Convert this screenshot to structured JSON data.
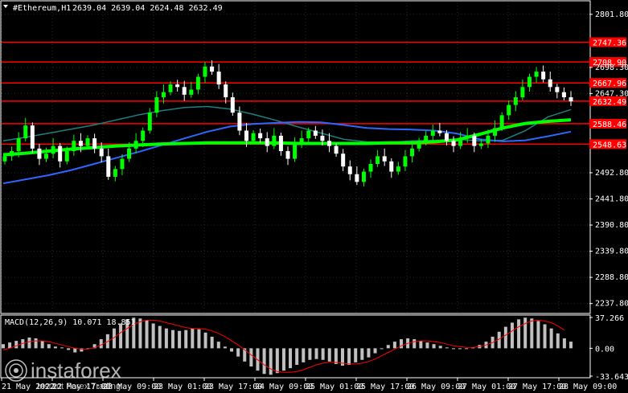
{
  "header": {
    "symbol": "#Ethereum,H1",
    "ohlc": "2639.04 2639.04 2624.48 2632.49"
  },
  "macd": {
    "label": "MACD(12,26,9) 10.071 18.851",
    "ticks": [
      "37.266",
      "0.00",
      "-33.643"
    ]
  },
  "watermark": {
    "brand": "instaforex",
    "tagline": "Instant Forex Trading"
  },
  "colors": {
    "background": "#000000",
    "bull_candle": "#00ff00",
    "bear_candle": "#ffffff",
    "level_line": "#ff0000",
    "ma_fast": "#00ff00",
    "ma_mid": "#2f66ff",
    "ma_slow": "#1f7f7f",
    "macd_hist": "#c0c0c0",
    "macd_signal": "#ff0000"
  },
  "chart_data": [
    {
      "type": "candlestick",
      "ylim": [
        2220,
        2825
      ],
      "y_ticks": [
        2801.8,
        2698.3,
        2647.3,
        2492.8,
        2441.8,
        2390.8,
        2339.8,
        2288.8,
        2237.8
      ],
      "x_labels": [
        "21 May 2022",
        "22 May 17:00",
        "23 May 09:00",
        "23 May 01:00",
        "23 May 17:00",
        "24 May 09:00",
        "25 May 01:00",
        "25 May 17:00",
        "26 May 09:00",
        "27 May 01:00",
        "27 May 17:00",
        "28 May 09:00"
      ],
      "levels": [
        {
          "value": 2747.36,
          "label": "2747.36"
        },
        {
          "value": 2708.9,
          "label": "2708.90"
        },
        {
          "value": 2667.96,
          "label": "2667.96"
        },
        {
          "value": 2632.49,
          "label": "2632.49"
        },
        {
          "value": 2588.46,
          "label": "2588.46"
        },
        {
          "value": 2548.63,
          "label": "2548.63"
        }
      ],
      "close": [
        2525,
        2535,
        2560,
        2585,
        2540,
        2520,
        2530,
        2545,
        2515,
        2535,
        2555,
        2545,
        2560,
        2540,
        2525,
        2485,
        2500,
        2520,
        2540,
        2555,
        2575,
        2610,
        2640,
        2650,
        2665,
        2660,
        2645,
        2655,
        2680,
        2700,
        2690,
        2665,
        2640,
        2610,
        2575,
        2555,
        2570,
        2560,
        2545,
        2565,
        2535,
        2520,
        2550,
        2560,
        2575,
        2565,
        2555,
        2545,
        2530,
        2505,
        2490,
        2475,
        2495,
        2510,
        2525,
        2515,
        2495,
        2505,
        2525,
        2540,
        2555,
        2565,
        2575,
        2570,
        2555,
        2545,
        2560,
        2565,
        2545,
        2550,
        2565,
        2580,
        2605,
        2625,
        2640,
        2660,
        2680,
        2690,
        2675,
        2660,
        2650,
        2640,
        2632
      ],
      "series": [
        {
          "key": "ma_fast",
          "values": [
            2528,
            2531,
            2535,
            2539,
            2542,
            2545,
            2547,
            2549,
            2550,
            2551,
            2551,
            2551,
            2551,
            2550,
            2550,
            2550,
            2550,
            2551,
            2551,
            2553,
            2557,
            2568,
            2580,
            2589,
            2593,
            2596
          ]
        },
        {
          "key": "ma_mid",
          "values": [
            2472,
            2480,
            2488,
            2498,
            2510,
            2522,
            2534,
            2547,
            2560,
            2573,
            2583,
            2588,
            2590,
            2592,
            2591,
            2586,
            2580,
            2578,
            2577,
            2575,
            2569,
            2558,
            2554,
            2556,
            2564,
            2573
          ]
        },
        {
          "key": "ma_slow",
          "values": [
            2555,
            2562,
            2570,
            2578,
            2586,
            2596,
            2606,
            2614,
            2620,
            2622,
            2617,
            2607,
            2595,
            2582,
            2570,
            2558,
            2553,
            2552,
            2555,
            2556,
            2558,
            2555,
            2556,
            2575,
            2602,
            2616
          ]
        }
      ]
    },
    {
      "type": "bar",
      "name": "MACD",
      "ylim": [
        -33.643,
        37.266
      ],
      "values": [
        5,
        7,
        9,
        11,
        13,
        12,
        9,
        5,
        2,
        1,
        -2,
        -5,
        -4,
        0,
        5,
        11,
        17,
        24,
        30,
        35,
        37,
        36,
        34,
        30,
        27,
        24,
        22,
        21,
        22,
        24,
        23,
        19,
        14,
        8,
        2,
        -4,
        -10,
        -16,
        -22,
        -27,
        -31,
        -32,
        -30,
        -27,
        -24,
        -20,
        -17,
        -14,
        -13,
        -14,
        -16,
        -19,
        -21,
        -20,
        -17,
        -14,
        -11,
        -6,
        -1,
        4,
        8,
        11,
        12,
        11,
        9,
        7,
        5,
        3,
        1,
        -1,
        -1,
        0,
        1,
        4,
        8,
        14,
        20,
        26,
        31,
        35,
        37,
        36,
        33,
        29,
        24,
        18,
        12,
        8
      ],
      "signal": [
        -2,
        0,
        3,
        6,
        8,
        9,
        9,
        8,
        6,
        4,
        2,
        0,
        -1,
        -1,
        1,
        4,
        8,
        13,
        19,
        24,
        29,
        32,
        34,
        34,
        33,
        31,
        29,
        27,
        25,
        24,
        24,
        23,
        21,
        18,
        14,
        9,
        4,
        -2,
        -8,
        -14,
        -20,
        -25,
        -28,
        -29,
        -29,
        -28,
        -26,
        -23,
        -20,
        -18,
        -17,
        -17,
        -18,
        -19,
        -19,
        -18,
        -16,
        -13,
        -9,
        -5,
        -1,
        3,
        6,
        8,
        9,
        9,
        8,
        7,
        5,
        3,
        2,
        1,
        1,
        2,
        4,
        7,
        11,
        16,
        21,
        26,
        30,
        33,
        34,
        33,
        31,
        27,
        22
      ]
    }
  ]
}
